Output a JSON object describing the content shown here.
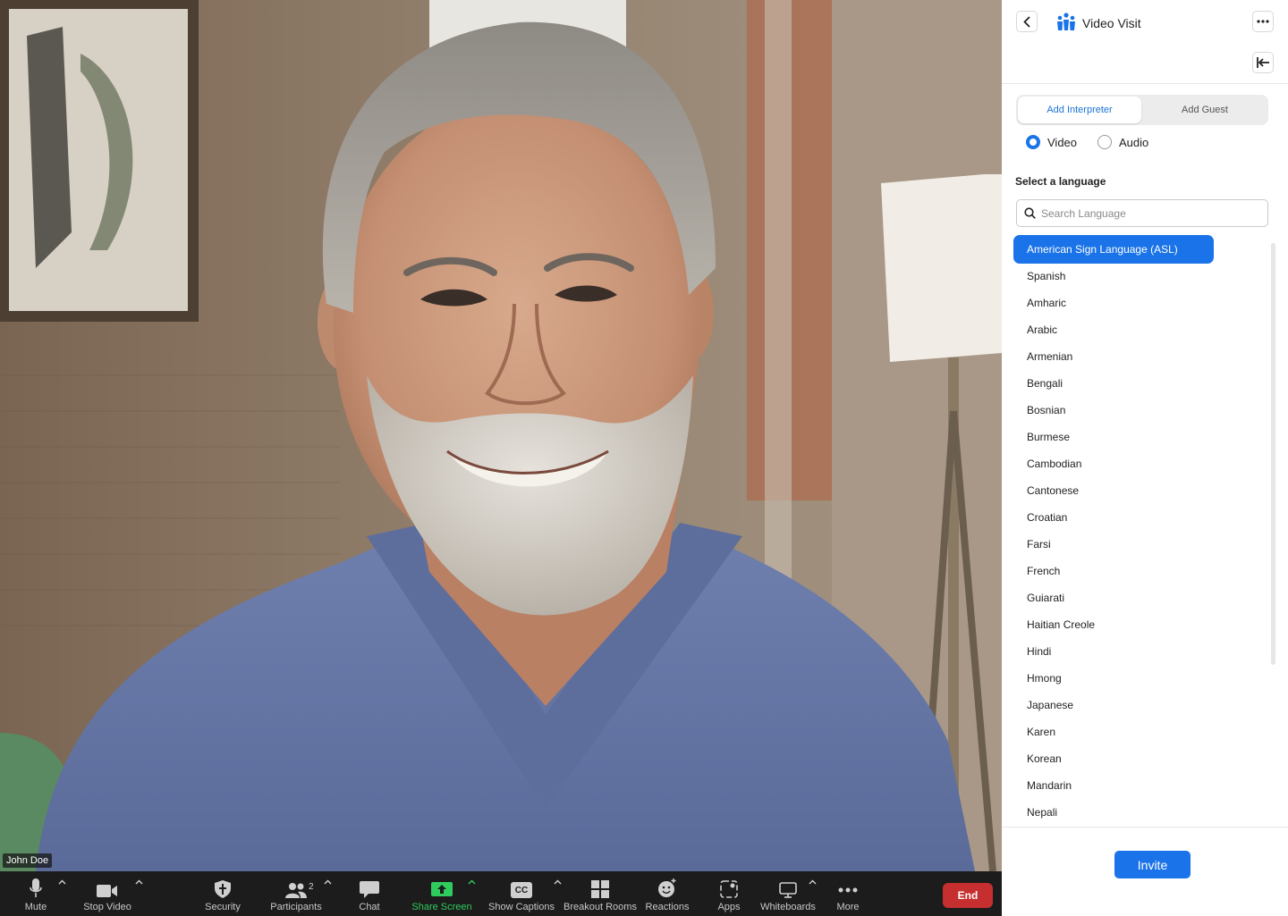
{
  "video": {
    "participant_name": "John Doe"
  },
  "toolbar": {
    "mute": "Mute",
    "stop_video": "Stop Video",
    "security": "Security",
    "participants": "Participants",
    "participants_count": "2",
    "chat": "Chat",
    "share_screen": "Share Screen",
    "show_captions": "Show Captions",
    "captions_glyph": "CC",
    "breakout_rooms": "Breakout Rooms",
    "reactions": "Reactions",
    "apps": "Apps",
    "whiteboards": "Whiteboards",
    "more": "More",
    "end": "End"
  },
  "panel": {
    "title": "Video Visit",
    "tabs": [
      "Add Interpreter",
      "Add Guest"
    ],
    "active_tab": "Add Interpreter",
    "mode_options": [
      "Video",
      "Audio"
    ],
    "selected_mode": "Video",
    "select_language_label": "Select a language",
    "search_placeholder": "Search Language",
    "languages": [
      "American Sign Language (ASL)",
      "Spanish",
      "Amharic",
      "Arabic",
      "Armenian",
      "Bengali",
      "Bosnian",
      "Burmese",
      "Cambodian",
      "Cantonese",
      "Croatian",
      "Farsi",
      "French",
      "Guiarati",
      "Haitian Creole",
      "Hindi",
      "Hmong",
      "Japanese",
      "Karen",
      "Korean",
      "Mandarin",
      "Nepali"
    ],
    "selected_language": "American Sign Language (ASL)",
    "invite_label": "Invite"
  },
  "colors": {
    "accent": "#1a73e8",
    "end_button": "#c62f2f",
    "share_green": "#2fcb5c"
  },
  "icons": {
    "back": "chevron-left-icon",
    "brand": "people-icon",
    "more": "ellipsis-icon",
    "collapse": "collapse-left-icon",
    "search": "search-icon"
  }
}
